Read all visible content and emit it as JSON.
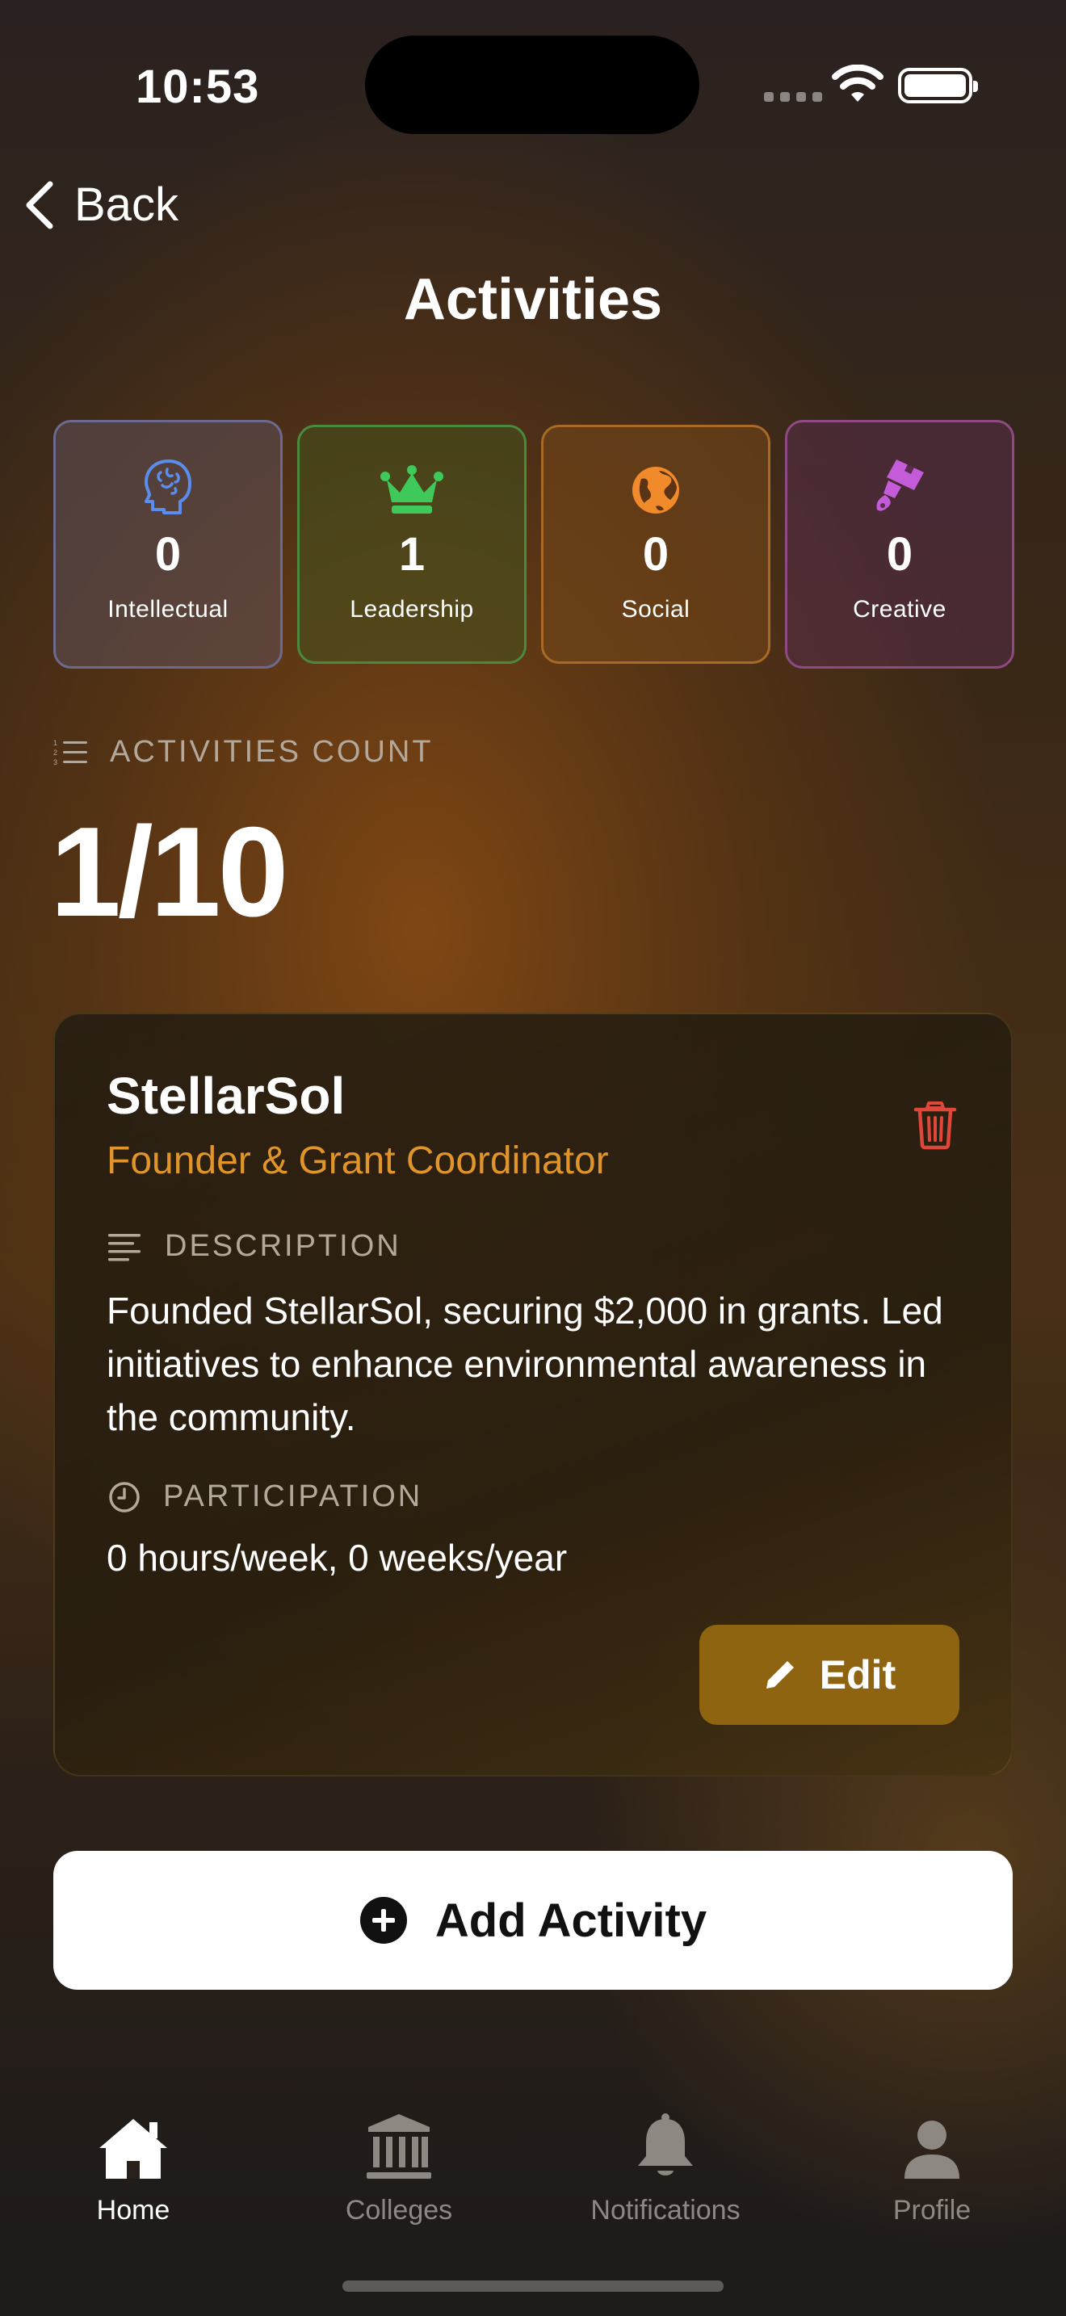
{
  "status_bar": {
    "time": "10:53"
  },
  "nav": {
    "back_label": "Back",
    "title": "Activities"
  },
  "categories": [
    {
      "label": "Intellectual",
      "count": "0",
      "icon": "brain-icon",
      "color": "#5b8def"
    },
    {
      "label": "Leadership",
      "count": "1",
      "icon": "crown-icon",
      "color": "#3ec95a"
    },
    {
      "label": "Social",
      "count": "0",
      "icon": "globe-icon",
      "color": "#f08a2a"
    },
    {
      "label": "Creative",
      "count": "0",
      "icon": "paintbrush-icon",
      "color": "#c45bd8"
    }
  ],
  "activities_count": {
    "label": "ACTIVITIES COUNT",
    "value": "1/10"
  },
  "activity": {
    "name": "StellarSol",
    "role": "Founder & Grant Coordinator",
    "description_label": "DESCRIPTION",
    "description": "Founded StellarSol, securing $2,000 in grants. Led initiatives to enhance environmental awareness in the community.",
    "participation_label": "PARTICIPATION",
    "participation": "0 hours/week, 0 weeks/year",
    "edit_label": "Edit"
  },
  "add_button_label": "Add Activity",
  "tab_bar": [
    {
      "label": "Home",
      "icon": "house-icon",
      "active": true
    },
    {
      "label": "Colleges",
      "icon": "building-columns-icon",
      "active": false
    },
    {
      "label": "Notifications",
      "icon": "bell-icon",
      "active": false
    },
    {
      "label": "Profile",
      "icon": "person-icon",
      "active": false
    }
  ],
  "colors": {
    "accent_gold": "#8f6410",
    "role_orange": "#e0952a",
    "delete_red": "#e0473a"
  }
}
